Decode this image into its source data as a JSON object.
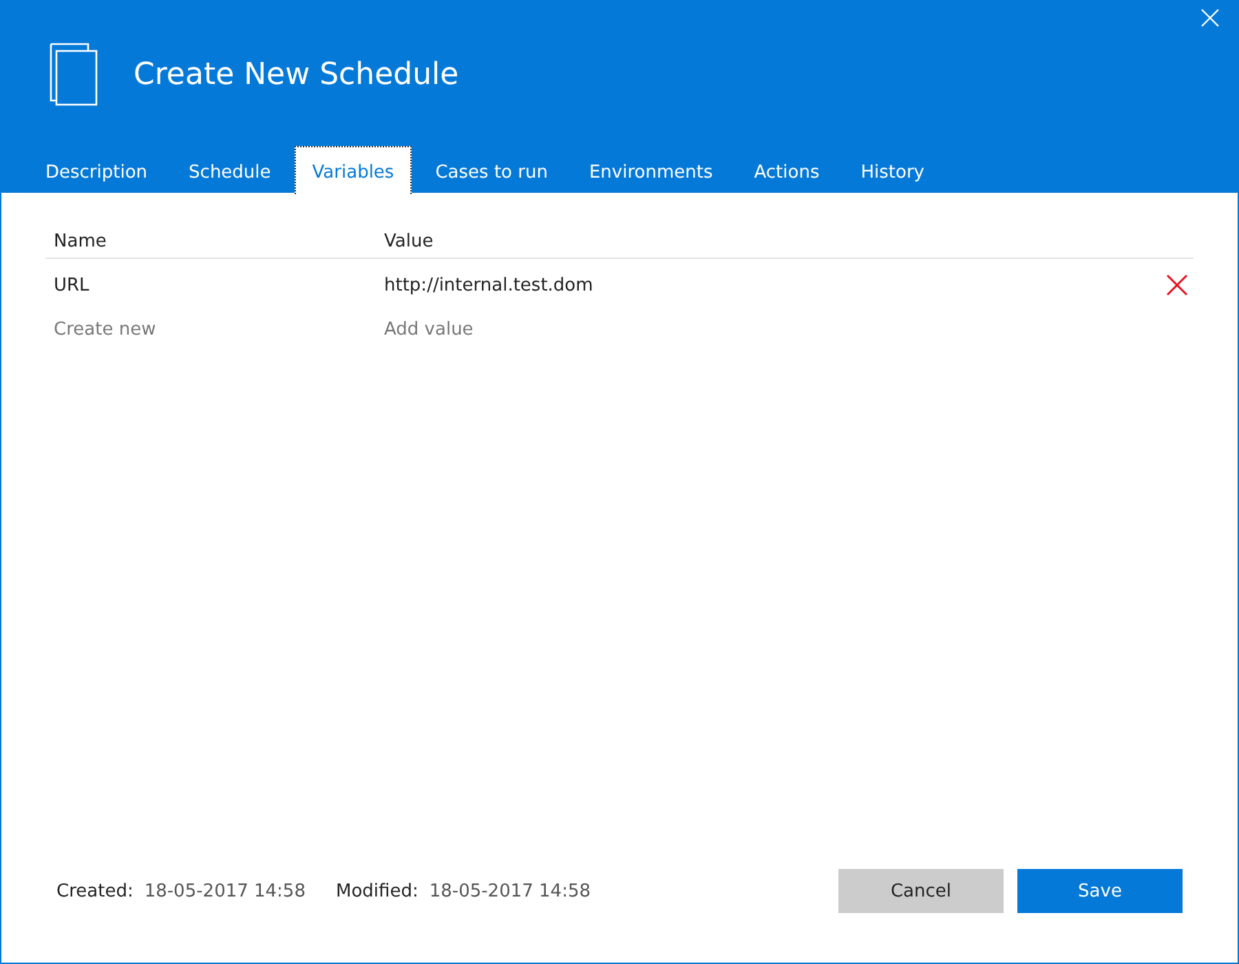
{
  "window": {
    "title": "Create New Schedule"
  },
  "tabs": [
    {
      "label": "Description",
      "selected": false
    },
    {
      "label": "Schedule",
      "selected": false
    },
    {
      "label": "Variables",
      "selected": true
    },
    {
      "label": "Cases to run",
      "selected": false
    },
    {
      "label": "Environments",
      "selected": false
    },
    {
      "label": "Actions",
      "selected": false
    },
    {
      "label": "History",
      "selected": false
    }
  ],
  "table": {
    "columns": [
      "Name",
      "Value"
    ],
    "rows": [
      {
        "name": "URL",
        "value": "http://internal.test.dom"
      }
    ],
    "new_row": {
      "name_placeholder": "Create new",
      "value_placeholder": "Add value"
    }
  },
  "footer": {
    "fields": [
      {
        "label": "Created:",
        "value": "18-05-2017 14:58"
      },
      {
        "label": "Modified:",
        "value": "18-05-2017 14:58"
      }
    ],
    "buttons": [
      {
        "label": "Cancel",
        "kind": "secondary"
      },
      {
        "label": "Save",
        "kind": "primary"
      }
    ]
  }
}
